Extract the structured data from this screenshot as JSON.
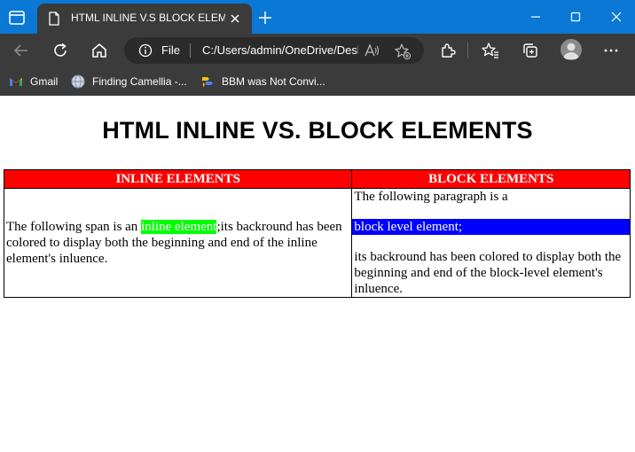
{
  "browser": {
    "tab": {
      "title": "HTML INLINE V.S BLOCK ELEMENTS"
    },
    "address": {
      "scheme": "File",
      "url": "C:/Users/admin/OneDrive/Desktop/inline-vs-block.html"
    },
    "bookmarks": [
      {
        "label": "Gmail",
        "icon": "gmail-icon"
      },
      {
        "label": "Finding Camellia -...",
        "icon": "globe-icon"
      },
      {
        "label": "BBM was Not Convi...",
        "icon": "bbm-icon"
      }
    ]
  },
  "page": {
    "heading": "HTML INLINE VS. BLOCK ELEMENTS",
    "table": {
      "headers": {
        "inline": "INLINE ELEMENTS",
        "block": "BLOCK ELEMENTS"
      },
      "inline_cell": {
        "before": "The following span is an ",
        "highlight": "inline element",
        "after": ";its backround has been colored to display both the beginning and end of the inline element's inluence."
      },
      "block_cell": {
        "intro": "The following paragraph is a",
        "highlight": "block level element;",
        "after": "its backround has been colored to display both the beginning and end of the block-level element's inluence."
      }
    }
  },
  "colors": {
    "titlebar": "#0a78d4",
    "chrome": "#3b3b3b",
    "header_bg": "#ff0000",
    "inline_highlight": "#00ff00",
    "block_highlight": "#0000ff"
  }
}
